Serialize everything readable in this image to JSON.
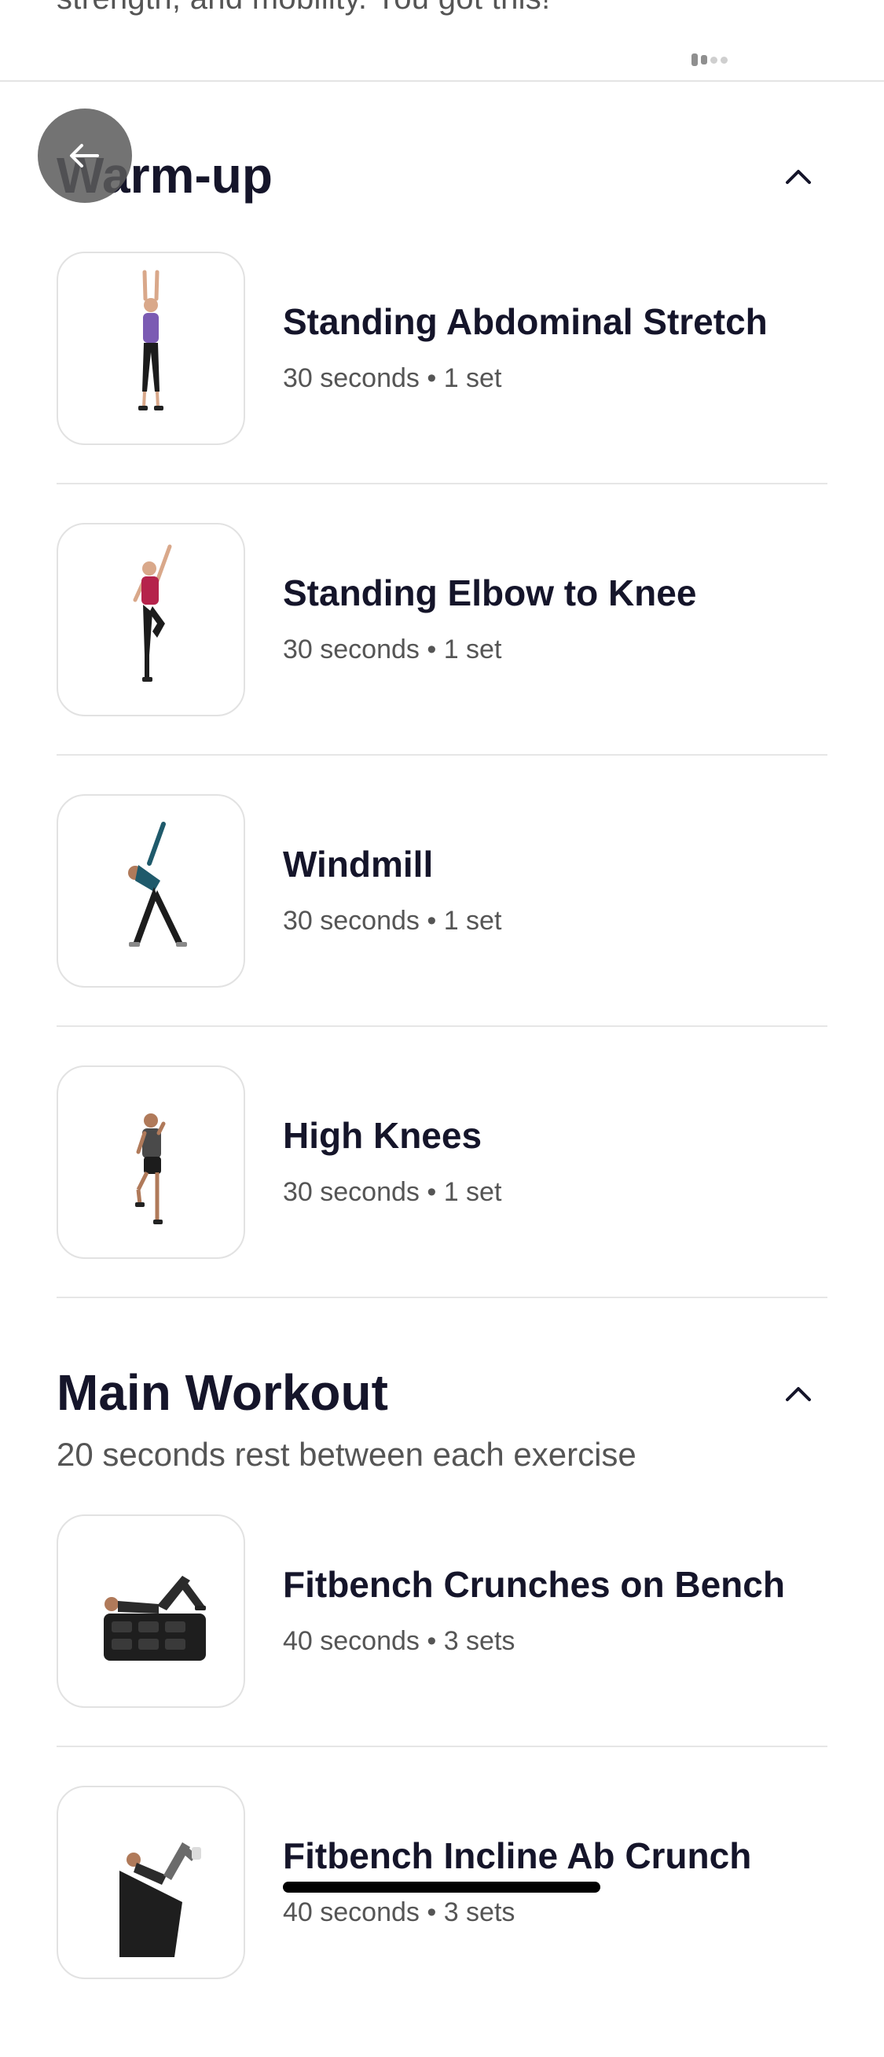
{
  "header": {
    "partial_text": "strength, and mobility. You got this!"
  },
  "sections": [
    {
      "title": "Warm-up",
      "subtitle": "",
      "exercises": [
        {
          "name": "Standing Abdominal Stretch",
          "meta": "30 seconds • 1 set",
          "shirt_color": "#7b5bb3"
        },
        {
          "name": "Standing Elbow to Knee",
          "meta": "30 seconds • 1 set",
          "shirt_color": "#b5234b"
        },
        {
          "name": "Windmill",
          "meta": "30 seconds • 1 set",
          "shirt_color": "#1f5a6b"
        },
        {
          "name": "High Knees",
          "meta": "30 seconds • 1 set",
          "shirt_color": "#4a4a4a"
        }
      ]
    },
    {
      "title": "Main Workout",
      "subtitle": "20 seconds rest between each exercise",
      "exercises": [
        {
          "name": "Fitbench Crunches on Bench",
          "meta": "40 seconds • 3 sets",
          "shirt_color": "#2b2b2b"
        },
        {
          "name": "Fitbench Incline Ab Crunch",
          "meta": "40 seconds • 3 sets",
          "shirt_color": "#2b2b2b"
        }
      ]
    }
  ],
  "icons": {
    "back": "arrow-left-icon",
    "collapse": "chevron-up-icon"
  }
}
